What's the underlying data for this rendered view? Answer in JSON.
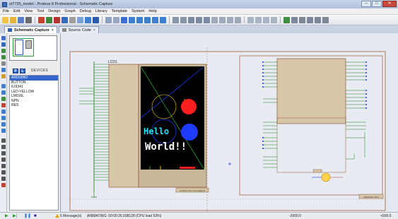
{
  "window": {
    "title": "st7735_model - Proteus 8 Professional - Schematic Capture",
    "min": "–",
    "max": "□",
    "close": "✕"
  },
  "menu": [
    "File",
    "Edit",
    "View",
    "Tool",
    "Design",
    "Graph",
    "Debug",
    "Library",
    "Template",
    "System",
    "Help"
  ],
  "tabs": [
    {
      "label": "Schematic Capture",
      "close": "×",
      "active": true
    },
    {
      "label": "Source Code",
      "close": "×",
      "active": false
    }
  ],
  "panel": {
    "p_button": "P",
    "l_button": "L",
    "devices_label": "DEVICES",
    "devices": [
      "ARDUINO",
      "BUTTON",
      "ILI9341",
      "LED-YELLOW",
      "LM016L",
      "NPN",
      "RES"
    ],
    "selected": "ARDUINO"
  },
  "schematic": {
    "lcd_ref": "LCD1",
    "lcd_caption": "2.4INCH TFT LCD SHIELD",
    "lcd_text_line1": "Hello",
    "lcd_text_line2": "World!!",
    "arduino_caption": "ARDUINO UNO"
  },
  "status": {
    "messages": "5 Message(s)",
    "animating": "ANIMATING: 00:00:26.938128 (CPU load 53%)",
    "coord_x": "-2000.0",
    "coord_y": "+500.0"
  },
  "colors": {
    "lcd_red": "#ff1f1f",
    "lcd_blue": "#1e3cff",
    "lcd_cyan": "#19e3ff",
    "wire": "#1e7a1e",
    "border": "#9b5a3a"
  }
}
